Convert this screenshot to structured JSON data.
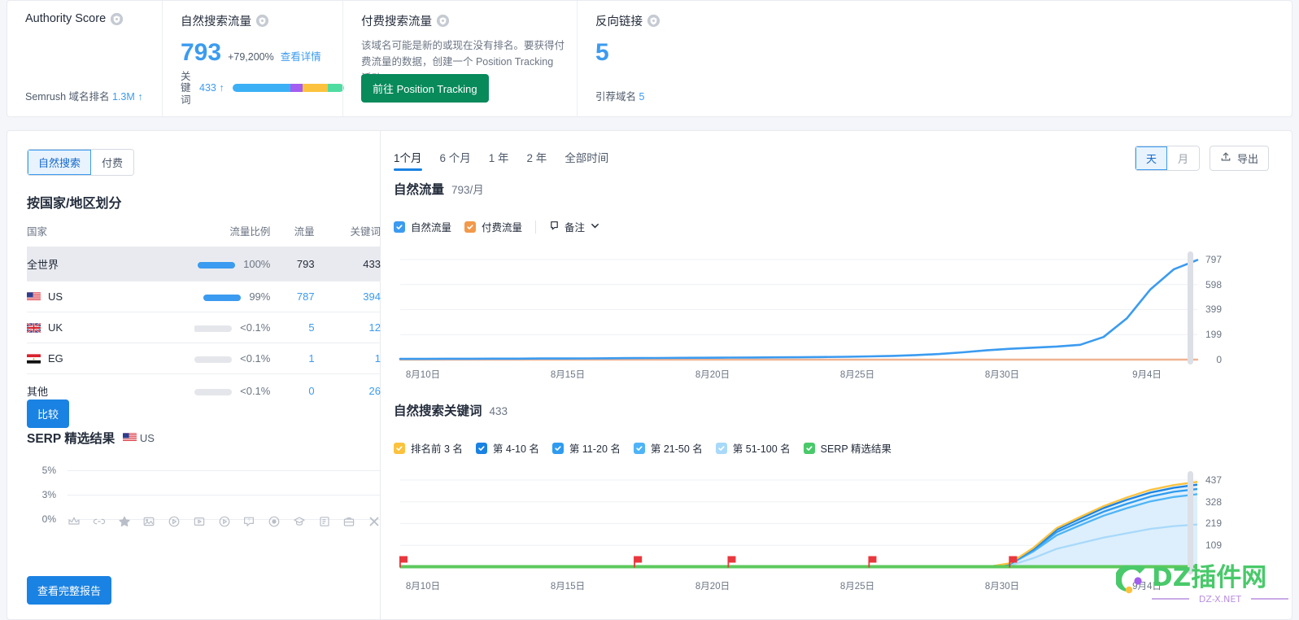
{
  "summary": {
    "authority": {
      "title": "Authority Score",
      "footer_label": "Semrush 域名排名",
      "footer_value": "1.3M",
      "footer_arrow": "↑"
    },
    "organic": {
      "title": "自然搜索流量",
      "value": "793",
      "delta": "+79,200%",
      "details_link": "查看详情",
      "kw_vertical_label": "关键词",
      "kw_count": "433",
      "kw_arrow": "↑",
      "kw_segments": [
        {
          "color": "#3bb0f5",
          "pct": 52
        },
        {
          "color": "#a35df0",
          "pct": 11
        },
        {
          "color": "#fcc23d",
          "pct": 23
        },
        {
          "color": "#4fdca0",
          "pct": 14
        }
      ]
    },
    "paid": {
      "title": "付费搜索流量",
      "description": "该域名可能是新的或现在没有排名。要获得付费流量的数据，创建一个 Position Tracking 活动。",
      "cta": "前往 Position Tracking"
    },
    "backlinks": {
      "title": "反向链接",
      "value": "5",
      "footer_label": "引荐域名",
      "footer_value": "5"
    }
  },
  "left": {
    "tabs": [
      {
        "label": "自然搜索",
        "active": true
      },
      {
        "label": "付费",
        "active": false
      }
    ],
    "section_title": "按国家/地区划分",
    "table": {
      "headers": [
        "国家",
        "流量比例",
        "流量",
        "关键词"
      ],
      "rows": [
        {
          "country": "全世界",
          "flag": "none",
          "bar_pct": 100,
          "bar_muted": false,
          "share": "100%",
          "traffic": "793",
          "keywords": "433",
          "highlight": true
        },
        {
          "country": "US",
          "flag": "us",
          "bar_pct": 99,
          "bar_muted": false,
          "share": "99%",
          "traffic": "787",
          "keywords": "394",
          "highlight": false
        },
        {
          "country": "UK",
          "flag": "uk",
          "bar_pct": 8,
          "bar_muted": true,
          "share": "<0.1%",
          "traffic": "5",
          "keywords": "12",
          "highlight": false
        },
        {
          "country": "EG",
          "flag": "eg",
          "bar_pct": 0,
          "bar_muted": true,
          "share": "<0.1%",
          "traffic": "1",
          "keywords": "1",
          "highlight": false
        },
        {
          "country": "其他",
          "flag": "none",
          "bar_pct": 0,
          "bar_muted": true,
          "share": "<0.1%",
          "traffic": "0",
          "keywords": "26",
          "highlight": false
        }
      ]
    },
    "compare_button": "比较",
    "serp": {
      "title": "SERP 精选结果",
      "country": "US",
      "y_labels": [
        "5%",
        "3%",
        "0%"
      ],
      "icons": [
        "crown-icon",
        "link-icon",
        "star-icon",
        "image-icon",
        "video-play-icon",
        "video-box-icon",
        "video-circle-icon",
        "faq-icon",
        "map-pin-icon",
        "knowledge-icon",
        "document-icon",
        "jobs-icon",
        "x-twitter-icon"
      ]
    },
    "full_report_button": "查看完整报告"
  },
  "right": {
    "range_tabs": [
      {
        "label": "1个月",
        "active": true
      },
      {
        "label": "6 个月",
        "active": false
      },
      {
        "label": "1 年",
        "active": false
      },
      {
        "label": "2 年",
        "active": false
      },
      {
        "label": "全部时间",
        "active": false
      }
    ],
    "granularity": [
      {
        "label": "天",
        "active": true
      },
      {
        "label": "月",
        "active": false
      }
    ],
    "export_button": "导出",
    "notes_label": "备注"
  },
  "chart_data": [
    {
      "type": "line",
      "title": "自然流量",
      "subtitle": "793/月",
      "legend": [
        {
          "label": "自然流量",
          "color": "#3b9bf0",
          "checked": true
        },
        {
          "label": "付费流量",
          "color": "#f2994a",
          "checked": true
        }
      ],
      "legend_position": "top",
      "grid": true,
      "ylabel": "",
      "xlabel": "",
      "ylim": [
        0,
        797
      ],
      "yticks": [
        797,
        598,
        399,
        199,
        0
      ],
      "x": [
        "8月10日",
        "8月15日",
        "8月20日",
        "8月25日",
        "8月30日",
        "9月4日"
      ],
      "xticks": [
        "8月10日",
        "8月15日",
        "8月20日",
        "8月25日",
        "8月30日",
        "9月4日"
      ],
      "series": [
        {
          "name": "自然流量",
          "color": "#3b9bf0",
          "values": [
            6,
            6,
            7,
            7,
            8,
            8,
            9,
            9,
            10,
            11,
            12,
            13,
            14,
            15,
            16,
            17,
            18,
            19,
            21,
            23,
            26,
            30,
            36,
            45,
            58,
            74,
            86,
            95,
            104,
            118,
            180,
            330,
            560,
            720,
            793
          ]
        },
        {
          "name": "付费流量",
          "color": "#f0b392",
          "values": [
            0,
            0,
            0,
            0,
            0,
            0,
            0,
            0,
            0,
            0,
            0,
            0,
            0,
            0,
            0,
            0,
            0,
            0,
            0,
            0,
            0,
            0,
            0,
            0,
            0,
            0,
            0,
            0,
            0,
            0,
            0,
            0,
            0,
            0,
            0
          ]
        }
      ]
    },
    {
      "type": "area",
      "title": "自然搜索关键词",
      "subtitle": "433",
      "legend": [
        {
          "label": "排名前 3 名",
          "color": "#fcc23d",
          "checked": true
        },
        {
          "label": "第 4-10 名",
          "color": "#1a82e2",
          "checked": true
        },
        {
          "label": "第 11-20 名",
          "color": "#2e9bf0",
          "checked": true
        },
        {
          "label": "第 21-50 名",
          "color": "#4eb4f7",
          "checked": true
        },
        {
          "label": "第 51-100 名",
          "color": "#a8d9fa",
          "checked": true
        },
        {
          "label": "SERP 精选结果",
          "color": "#49c96a",
          "checked": true
        }
      ],
      "legend_position": "top",
      "grid": true,
      "ylim": [
        0,
        437
      ],
      "yticks": [
        437,
        328,
        219,
        109
      ],
      "x": [
        "8月10日",
        "8月15日",
        "8月20日",
        "8月25日",
        "8月30日",
        "9月4日"
      ],
      "xticks": [
        "8月10日",
        "8月15日",
        "8月20日",
        "8月25日",
        "8月30日",
        "9月4日"
      ],
      "series": [
        {
          "name": "第 51-100 名",
          "color": "#a8d9fa",
          "values": [
            0,
            0,
            0,
            0,
            0,
            0,
            0,
            0,
            0,
            0,
            0,
            0,
            0,
            0,
            0,
            0,
            0,
            0,
            0,
            0,
            0,
            0,
            0,
            0,
            0,
            0,
            8,
            45,
            92,
            120,
            148,
            170,
            192,
            206,
            214
          ]
        },
        {
          "name": "第 21-50 名",
          "color": "#4eb4f7",
          "values": [
            0,
            0,
            0,
            0,
            0,
            0,
            0,
            0,
            0,
            0,
            0,
            0,
            0,
            0,
            0,
            0,
            0,
            0,
            0,
            0,
            0,
            0,
            0,
            0,
            0,
            0,
            14,
            78,
            160,
            210,
            258,
            296,
            330,
            352,
            366
          ]
        },
        {
          "name": "第 11-20 名",
          "color": "#2e9bf0",
          "values": [
            0,
            0,
            0,
            0,
            0,
            0,
            0,
            0,
            0,
            0,
            0,
            0,
            0,
            0,
            0,
            0,
            0,
            0,
            0,
            0,
            0,
            0,
            0,
            0,
            0,
            0,
            16,
            86,
            176,
            228,
            278,
            318,
            354,
            378,
            392
          ]
        },
        {
          "name": "第 4-10 名",
          "color": "#1a82e2",
          "values": [
            0,
            0,
            0,
            0,
            0,
            0,
            0,
            0,
            0,
            0,
            0,
            0,
            0,
            0,
            0,
            0,
            0,
            0,
            0,
            0,
            0,
            0,
            0,
            0,
            0,
            0,
            18,
            92,
            188,
            243,
            296,
            338,
            374,
            398,
            414
          ]
        },
        {
          "name": "排名前 3 名",
          "color": "#fcc23d",
          "values": [
            0,
            0,
            0,
            0,
            0,
            0,
            0,
            0,
            0,
            0,
            0,
            0,
            0,
            0,
            0,
            0,
            0,
            0,
            0,
            0,
            0,
            0,
            0,
            0,
            0,
            0,
            19,
            96,
            196,
            252,
            306,
            350,
            388,
            412,
            428
          ]
        },
        {
          "name": "SERP 精选结果",
          "color": "#49c96a",
          "values": [
            2,
            2,
            2,
            2,
            2,
            2,
            2,
            2,
            2,
            2,
            2,
            2,
            2,
            2,
            2,
            2,
            2,
            2,
            2,
            2,
            2,
            2,
            2,
            2,
            2,
            2,
            2,
            2,
            2,
            2,
            2,
            2,
            2,
            2,
            2
          ]
        }
      ],
      "annotations": [
        {
          "marker": "red-flag",
          "x_index": 0
        },
        {
          "marker": "red-flag",
          "x_index": 10
        },
        {
          "marker": "red-flag",
          "x_index": 14
        },
        {
          "marker": "red-flag",
          "x_index": 20
        },
        {
          "marker": "red-flag",
          "x_index": 26
        }
      ]
    }
  ],
  "watermark": {
    "text": "DZ插件网",
    "sub": "DZ-X.NET"
  }
}
